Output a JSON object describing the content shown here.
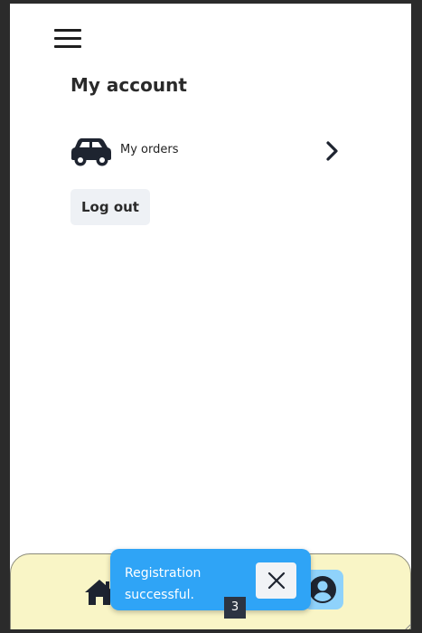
{
  "header": {
    "menu_icon": "hamburger-menu-icon"
  },
  "main": {
    "title": "My account",
    "orders": {
      "icon": "car-icon",
      "label": "My orders",
      "chevron_icon": "chevron-right-icon"
    },
    "logout_label": "Log out"
  },
  "bottom_nav": {
    "home_icon": "home-icon",
    "account_icon": "account-icon",
    "account_active_color": "#8fd2fb",
    "background": "#f9f5c6"
  },
  "toast": {
    "message": "Registration successful.",
    "close_icon": "close-icon",
    "count": "3",
    "color": "#2fa4f6"
  }
}
